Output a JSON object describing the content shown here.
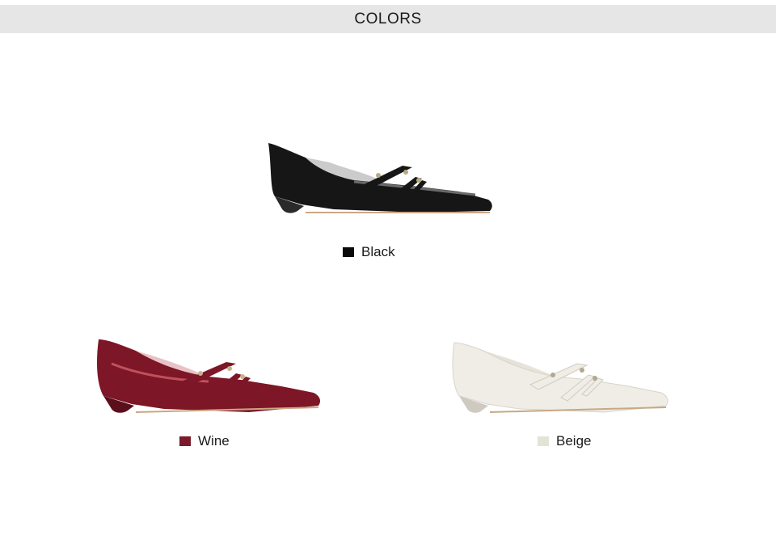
{
  "header": {
    "title": "COLORS"
  },
  "variants": [
    {
      "name": "Black",
      "swatch_color": "#0a0a0a",
      "shoe_color": "#161616",
      "shoe_highlight": "#6a6a6a",
      "sole_color": "#2a2a2a"
    },
    {
      "name": "Wine",
      "swatch_color": "#7a1a2a",
      "shoe_color": "#7d1626",
      "shoe_highlight": "#c0505e",
      "sole_color": "#5a0f1a"
    },
    {
      "name": "Beige",
      "swatch_color": "#e3e3d6",
      "shoe_color": "#efede6",
      "shoe_highlight": "#ffffff",
      "sole_color": "#cfcac0"
    }
  ]
}
